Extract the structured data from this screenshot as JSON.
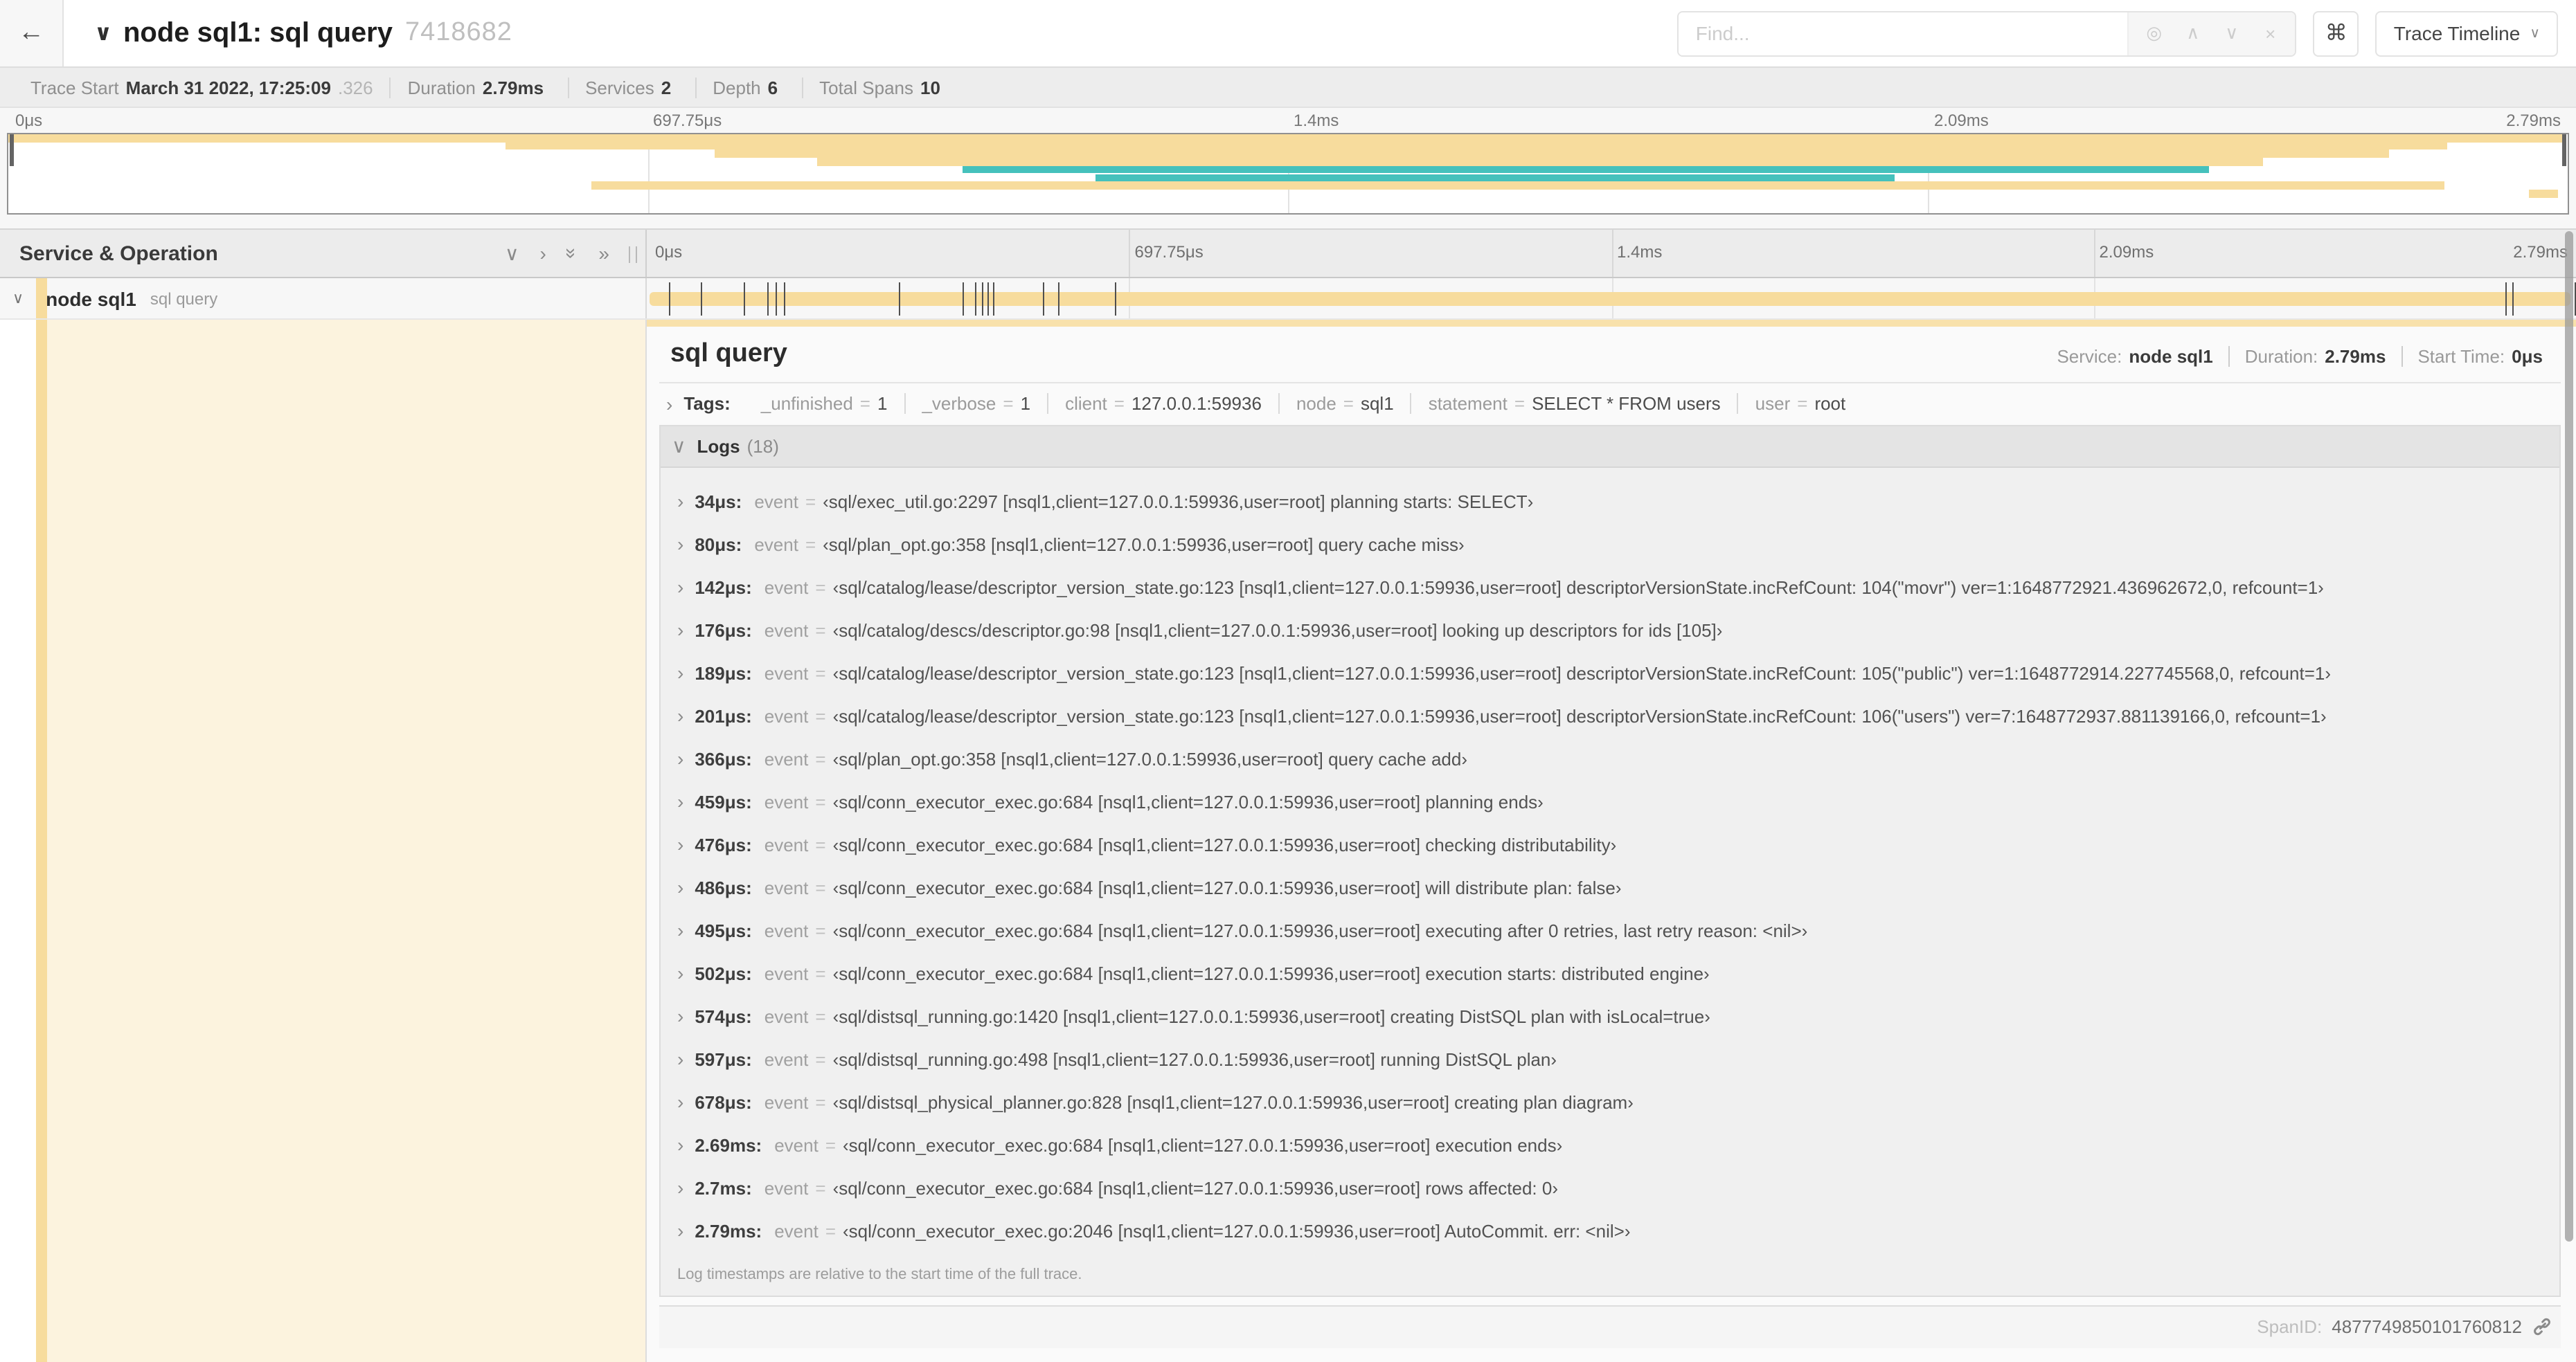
{
  "icons": {
    "back": "←",
    "chevron_down": "∨",
    "chevron_right": "›",
    "double_chevron": "»",
    "locate": "◎",
    "prev": "∧",
    "next": "∨",
    "clear": "×",
    "shortcut": "⌘"
  },
  "header": {
    "title": "node sql1: sql query",
    "trace_id": "7418682",
    "find_placeholder": "Find...",
    "view_button": "Trace Timeline"
  },
  "stats": [
    {
      "label": "Trace Start",
      "value": "March 31 2022, 17:25:09",
      "suffix": ".326"
    },
    {
      "label": "Duration",
      "value": "2.79ms",
      "suffix": ""
    },
    {
      "label": "Services",
      "value": "2",
      "suffix": ""
    },
    {
      "label": "Depth",
      "value": "6",
      "suffix": ""
    },
    {
      "label": "Total Spans",
      "value": "10",
      "suffix": ""
    }
  ],
  "colors": {
    "tan": "#f7dc9d",
    "teal": "#45c1bc",
    "cream": "#fcf3de"
  },
  "minimap": {
    "ticks": [
      {
        "label": "0μs",
        "pos": 0
      },
      {
        "label": "697.75μs",
        "pos": 25
      },
      {
        "label": "1.4ms",
        "pos": 50
      },
      {
        "label": "2.09ms",
        "pos": 75
      },
      {
        "label": "2.79ms",
        "pos": 100
      }
    ],
    "rows": 10,
    "spans": [
      {
        "row": 1,
        "start": 0,
        "end": 99.8,
        "c": "tan"
      },
      {
        "row": 2,
        "start": 19.4,
        "end": 95.3,
        "c": "tan"
      },
      {
        "row": 3,
        "start": 27.6,
        "end": 93.0,
        "c": "tan"
      },
      {
        "row": 4,
        "start": 31.6,
        "end": 88.1,
        "c": "tan"
      },
      {
        "row": 5,
        "start": 37.3,
        "end": 86.0,
        "c": "teal"
      },
      {
        "row": 6,
        "start": 42.5,
        "end": 73.7,
        "c": "teal"
      },
      {
        "row": 7,
        "start": 22.8,
        "end": 95.2,
        "c": "tan"
      },
      {
        "row": 8,
        "start": 98.5,
        "end": 99.6,
        "c": "tan"
      }
    ]
  },
  "timeline_header": {
    "title": "Service & Operation",
    "ticks": [
      {
        "label": "0μs",
        "pos": 0
      },
      {
        "label": "697.75μs",
        "pos": 25
      },
      {
        "label": "1.4ms",
        "pos": 50
      },
      {
        "label": "2.09ms",
        "pos": 75
      },
      {
        "label": "2.79ms",
        "pos": 100
      }
    ]
  },
  "span_row": {
    "service": "node sql1",
    "operation": "sql query",
    "total_us": 2790,
    "log_ticks_us": [
      34,
      80,
      142,
      176,
      189,
      201,
      366,
      459,
      476,
      486,
      495,
      502,
      574,
      597,
      678,
      2690,
      2700,
      2790
    ]
  },
  "detail": {
    "operation": "sql query",
    "meta": [
      {
        "label": "Service:",
        "value": "node sql1"
      },
      {
        "label": "Duration:",
        "value": "2.79ms"
      },
      {
        "label": "Start Time:",
        "value": "0μs"
      }
    ],
    "tags_label": "Tags:",
    "tags": [
      {
        "key": "_unfinished",
        "eq": "=",
        "value": "1"
      },
      {
        "key": "_verbose",
        "eq": "=",
        "value": "1"
      },
      {
        "key": "client",
        "eq": "=",
        "value": "127.0.0.1:59936"
      },
      {
        "key": "node",
        "eq": "=",
        "value": "sql1"
      },
      {
        "key": "statement",
        "eq": "=",
        "value": "SELECT * FROM users"
      },
      {
        "key": "user",
        "eq": "=",
        "value": "root"
      }
    ],
    "logs_label": "Logs",
    "logs_count": "(18)",
    "logs": [
      {
        "time": "34μs:",
        "key": "event",
        "eq": "=",
        "value": "‹sql/exec_util.go:2297 [nsql1,client=127.0.0.1:59936,user=root] planning starts: SELECT›"
      },
      {
        "time": "80μs:",
        "key": "event",
        "eq": "=",
        "value": "‹sql/plan_opt.go:358 [nsql1,client=127.0.0.1:59936,user=root] query cache miss›"
      },
      {
        "time": "142μs:",
        "key": "event",
        "eq": "=",
        "value": "‹sql/catalog/lease/descriptor_version_state.go:123 [nsql1,client=127.0.0.1:59936,user=root] descriptorVersionState.incRefCount: 104(\"movr\") ver=1:1648772921.436962672,0, refcount=1›"
      },
      {
        "time": "176μs:",
        "key": "event",
        "eq": "=",
        "value": "‹sql/catalog/descs/descriptor.go:98 [nsql1,client=127.0.0.1:59936,user=root] looking up descriptors for ids [105]›"
      },
      {
        "time": "189μs:",
        "key": "event",
        "eq": "=",
        "value": "‹sql/catalog/lease/descriptor_version_state.go:123 [nsql1,client=127.0.0.1:59936,user=root] descriptorVersionState.incRefCount: 105(\"public\") ver=1:1648772914.227745568,0, refcount=1›"
      },
      {
        "time": "201μs:",
        "key": "event",
        "eq": "=",
        "value": "‹sql/catalog/lease/descriptor_version_state.go:123 [nsql1,client=127.0.0.1:59936,user=root] descriptorVersionState.incRefCount: 106(\"users\") ver=7:1648772937.881139166,0, refcount=1›"
      },
      {
        "time": "366μs:",
        "key": "event",
        "eq": "=",
        "value": "‹sql/plan_opt.go:358 [nsql1,client=127.0.0.1:59936,user=root] query cache add›"
      },
      {
        "time": "459μs:",
        "key": "event",
        "eq": "=",
        "value": "‹sql/conn_executor_exec.go:684 [nsql1,client=127.0.0.1:59936,user=root] planning ends›"
      },
      {
        "time": "476μs:",
        "key": "event",
        "eq": "=",
        "value": "‹sql/conn_executor_exec.go:684 [nsql1,client=127.0.0.1:59936,user=root] checking distributability›"
      },
      {
        "time": "486μs:",
        "key": "event",
        "eq": "=",
        "value": "‹sql/conn_executor_exec.go:684 [nsql1,client=127.0.0.1:59936,user=root] will distribute plan: false›"
      },
      {
        "time": "495μs:",
        "key": "event",
        "eq": "=",
        "value": "‹sql/conn_executor_exec.go:684 [nsql1,client=127.0.0.1:59936,user=root] executing after 0 retries, last retry reason: <nil>›"
      },
      {
        "time": "502μs:",
        "key": "event",
        "eq": "=",
        "value": "‹sql/conn_executor_exec.go:684 [nsql1,client=127.0.0.1:59936,user=root] execution starts: distributed engine›"
      },
      {
        "time": "574μs:",
        "key": "event",
        "eq": "=",
        "value": "‹sql/distsql_running.go:1420 [nsql1,client=127.0.0.1:59936,user=root] creating DistSQL plan with isLocal=true›"
      },
      {
        "time": "597μs:",
        "key": "event",
        "eq": "=",
        "value": "‹sql/distsql_running.go:498 [nsql1,client=127.0.0.1:59936,user=root] running DistSQL plan›"
      },
      {
        "time": "678μs:",
        "key": "event",
        "eq": "=",
        "value": "‹sql/distsql_physical_planner.go:828 [nsql1,client=127.0.0.1:59936,user=root] creating plan diagram›"
      },
      {
        "time": "2.69ms:",
        "key": "event",
        "eq": "=",
        "value": "‹sql/conn_executor_exec.go:684 [nsql1,client=127.0.0.1:59936,user=root] execution ends›"
      },
      {
        "time": "2.7ms:",
        "key": "event",
        "eq": "=",
        "value": "‹sql/conn_executor_exec.go:684 [nsql1,client=127.0.0.1:59936,user=root] rows affected: 0›"
      },
      {
        "time": "2.79ms:",
        "key": "event",
        "eq": "=",
        "value": "‹sql/conn_executor_exec.go:2046 [nsql1,client=127.0.0.1:59936,user=root] AutoCommit. err: <nil>›"
      }
    ],
    "logs_note": "Log timestamps are relative to the start time of the full trace.",
    "span_id_label": "SpanID:",
    "span_id": "4877749850101760812"
  }
}
